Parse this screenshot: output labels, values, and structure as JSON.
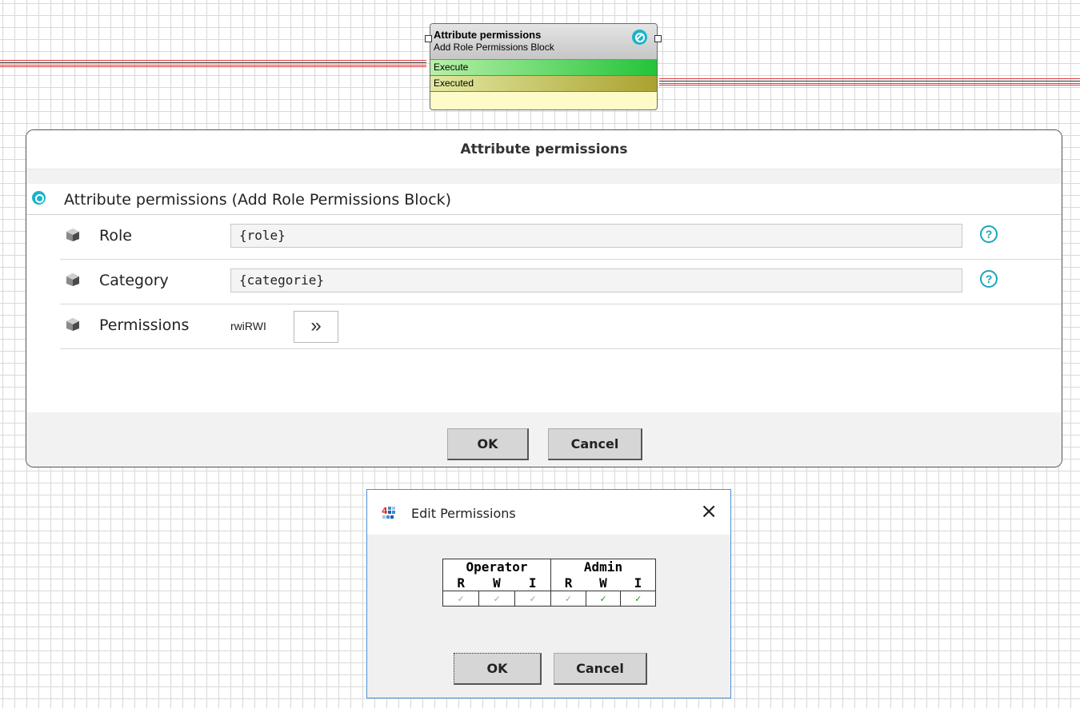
{
  "node": {
    "title": "Attribute permissions",
    "subtitle": "Add Role Permissions Block",
    "rows": [
      "Execute",
      "Executed"
    ],
    "icon": "block-status-icon"
  },
  "dialog": {
    "title": "Attribute permissions",
    "section": "Attribute permissions  (Add Role Permissions Block)",
    "params": [
      {
        "label": "Role",
        "value": "{role}",
        "has_help": true
      },
      {
        "label": "Category",
        "value": "{categorie}",
        "has_help": true
      },
      {
        "label": "Permissions",
        "value": "rwiRWI",
        "button_icon": "double-chevron-right-icon"
      }
    ],
    "help_glyph": "?",
    "ok_label": "OK",
    "cancel_label": "Cancel"
  },
  "edit_permissions": {
    "title": "Edit Permissions",
    "close_glyph": "×",
    "groups": [
      "Operator",
      "Admin"
    ],
    "columns": [
      "R",
      "W",
      "I",
      "R",
      "W",
      "I"
    ],
    "checks": [
      {
        "checked": false,
        "glyph": "✓"
      },
      {
        "checked": false,
        "glyph": "✓"
      },
      {
        "checked": false,
        "glyph": "✓"
      },
      {
        "checked": false,
        "glyph": "✓"
      },
      {
        "checked": true,
        "glyph": "✓"
      },
      {
        "checked": true,
        "glyph": "✓"
      }
    ],
    "ok_label": "OK",
    "cancel_label": "Cancel"
  },
  "colors": {
    "accent_teal": "#19b4c8",
    "wire_red": "#e23b3b",
    "checked_green": "#1a8a1a",
    "unchecked_gray": "#9a9a9a"
  }
}
